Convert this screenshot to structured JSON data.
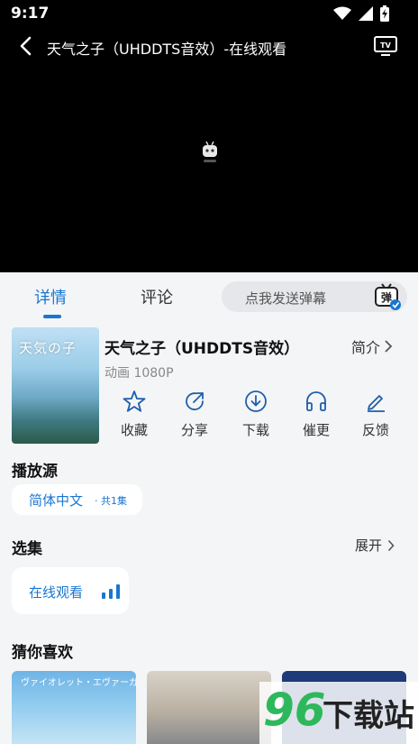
{
  "status_bar": {
    "time": "9:17",
    "icons": [
      "wifi-icon",
      "signal-icon",
      "battery-charging-icon"
    ]
  },
  "player": {
    "title": "天气之子（UHDDTS音效）-在线观看",
    "icons": {
      "back": "arrow-left-icon",
      "cast": "tv-icon",
      "loading": "loading-mascot-icon"
    }
  },
  "tabs": [
    {
      "label": "详情",
      "active": true
    },
    {
      "label": "评论",
      "active": false
    }
  ],
  "danmaku": {
    "placeholder": "点我发送弹幕",
    "button_label": "弹"
  },
  "movie": {
    "title": "天气之子（UHDDTS音效）",
    "intro_label": "简介",
    "meta": "动画 1080P",
    "poster_text": "天気の子"
  },
  "actions": [
    {
      "label": "收藏",
      "icon": "star-icon"
    },
    {
      "label": "分享",
      "icon": "share-icon"
    },
    {
      "label": "下载",
      "icon": "download-icon"
    },
    {
      "label": "催更",
      "icon": "headphones-icon"
    },
    {
      "label": "反馈",
      "icon": "edit-icon"
    }
  ],
  "source": {
    "section_title": "播放源",
    "label": "简体中文",
    "count": "· 共1集"
  },
  "episodes": {
    "section_title": "选集",
    "expand_label": "展开",
    "current": "在线观看"
  },
  "recommendations": {
    "section_title": "猜你喜欢",
    "items": [
      {
        "poster_text": "ヴァイオレット・エヴァーガーデン"
      },
      {},
      {}
    ]
  },
  "watermark": {
    "number": "96",
    "text": "下载站"
  },
  "colors": {
    "accent": "#1976d2",
    "background": "#f4f5f7",
    "player": "#000000"
  }
}
